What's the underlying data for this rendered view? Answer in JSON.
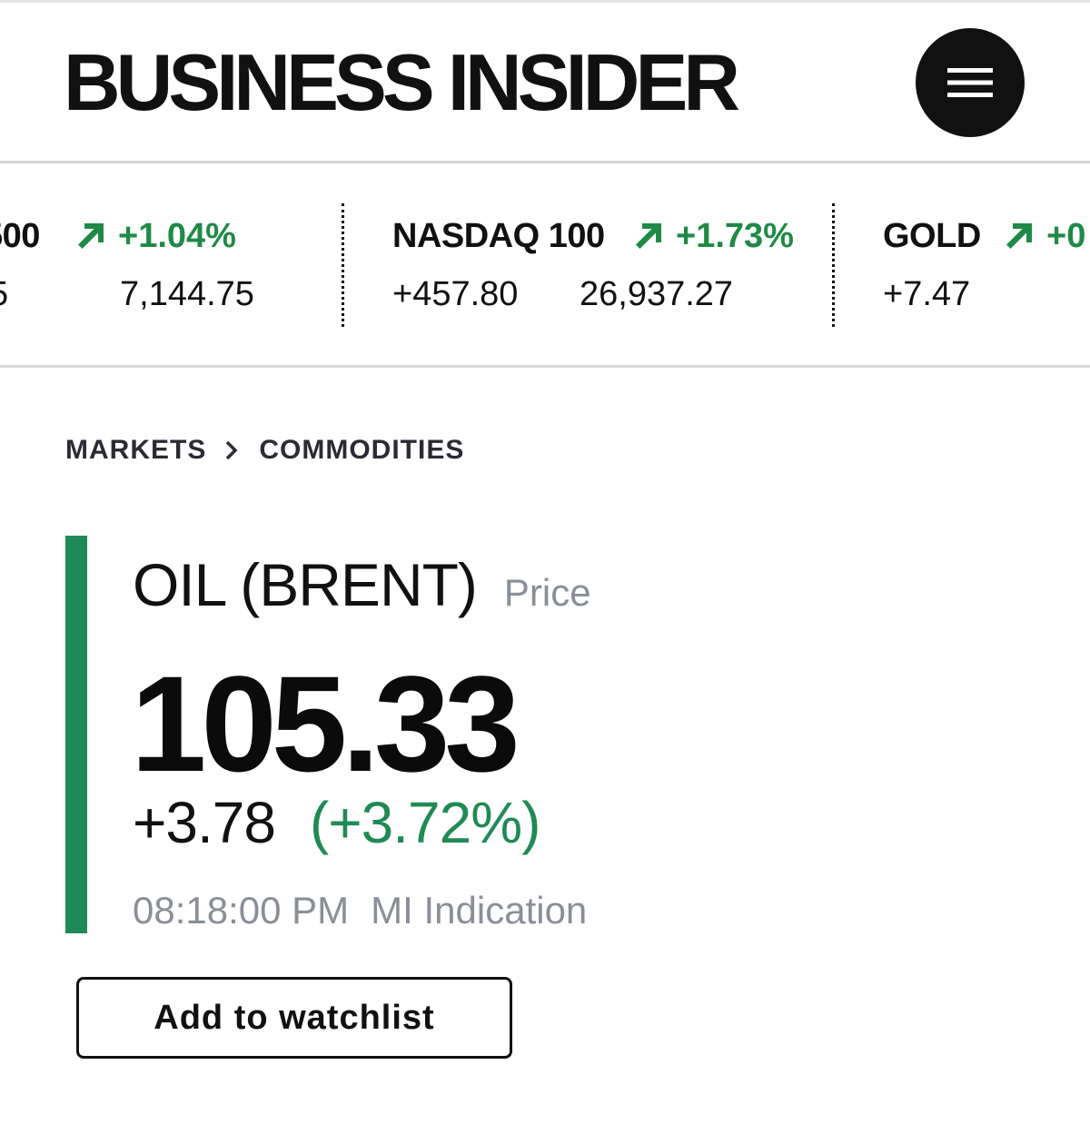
{
  "header": {
    "logo_text": "BUSINESS INSIDER",
    "menu_icon": "hamburger-icon"
  },
  "ticker": [
    {
      "name": "500",
      "pct": "+1.04%",
      "change": "5",
      "value": "7,144.75",
      "direction": "up"
    },
    {
      "name": "NASDAQ 100",
      "pct": "+1.73%",
      "change": "+457.80",
      "value": "26,937.27",
      "direction": "up"
    },
    {
      "name": "GOLD",
      "pct": "+0",
      "change": "+7.47",
      "value": "",
      "direction": "up"
    }
  ],
  "breadcrumb": {
    "items": [
      "MARKETS",
      "COMMODITIES"
    ],
    "separator_icon": "chevron-right-icon"
  },
  "quote": {
    "symbol": "OIL (BRENT)",
    "label": "Price",
    "price": "105.33",
    "change_abs": "+3.78",
    "change_pct": "(+3.72%)",
    "time": "08:18:00 PM",
    "source": "MI Indication"
  },
  "actions": {
    "watchlist_label": "Add to watchlist"
  },
  "colors": {
    "positive": "#1f8a46",
    "accent_bar": "#1f8a55",
    "muted": "#8a8f96",
    "text": "#111111"
  }
}
